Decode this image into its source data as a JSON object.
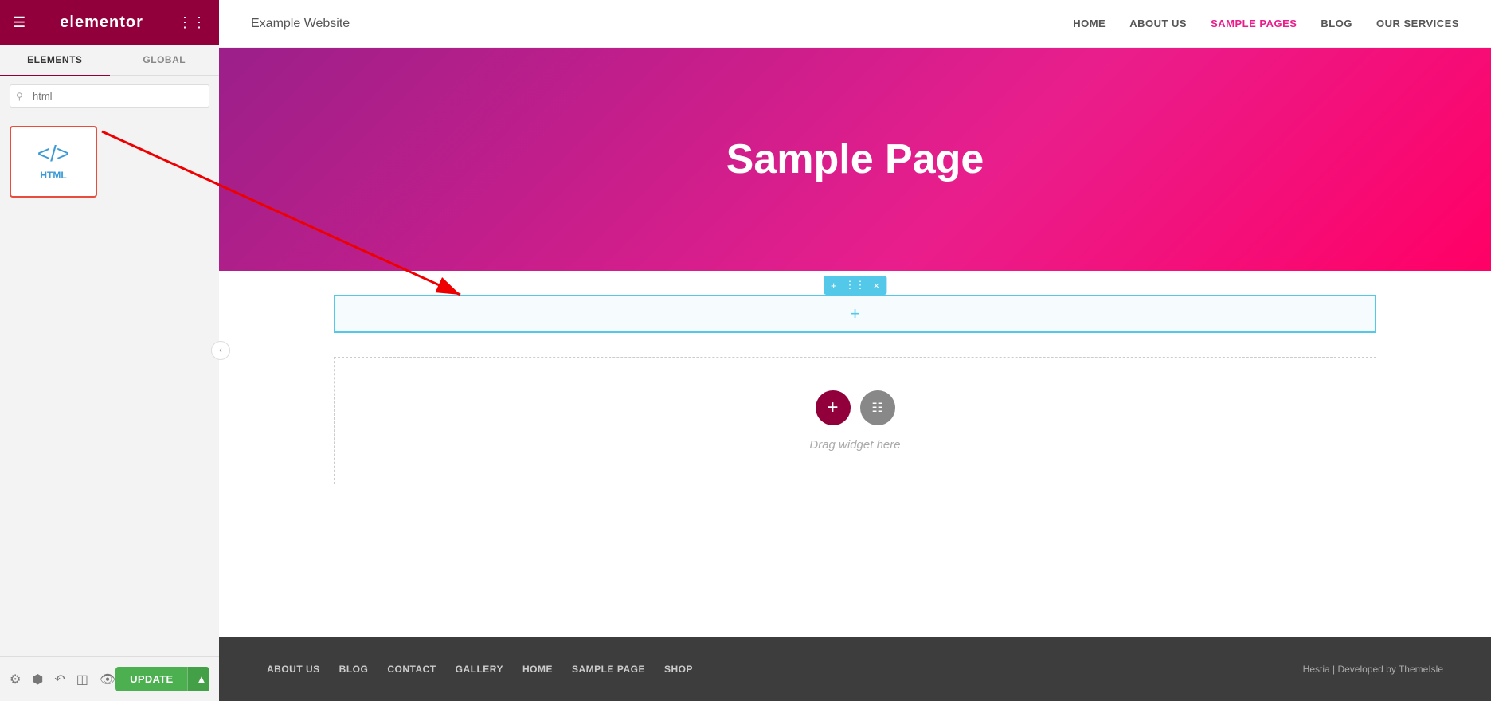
{
  "topbar": {
    "logo": "elementor",
    "hamburger_icon": "☰",
    "grid_icon": "⋮⋮"
  },
  "sidepanel": {
    "tabs": [
      {
        "id": "elements",
        "label": "ELEMENTS",
        "active": true
      },
      {
        "id": "global",
        "label": "GLOBAL",
        "active": false
      }
    ],
    "search_placeholder": "html",
    "widget": {
      "icon": "</>",
      "label": "HTML"
    }
  },
  "website": {
    "site_name": "Example Website",
    "nav_links": [
      {
        "label": "HOME",
        "active": false
      },
      {
        "label": "ABOUT US",
        "active": false
      },
      {
        "label": "SAMPLE PAGES",
        "active": true
      },
      {
        "label": "BLOG",
        "active": false
      },
      {
        "label": "OUR SERVICES",
        "active": false
      }
    ],
    "hero_title": "Sample Page",
    "selected_row_plus": "+",
    "drag_widget_label": "Drag widget here",
    "footer_links": [
      {
        "label": "ABOUT US"
      },
      {
        "label": "BLOG"
      },
      {
        "label": "CONTACT"
      },
      {
        "label": "GALLERY"
      },
      {
        "label": "HOME"
      },
      {
        "label": "SAMPLE PAGE"
      },
      {
        "label": "SHOP"
      }
    ],
    "footer_credit": "Hestia | Developed by ThemeIsle"
  },
  "bottom_toolbar": {
    "update_label": "UPDATE",
    "arrow_label": "▲",
    "icons": [
      "⚙",
      "⬡",
      "↶",
      "⊡",
      "👁"
    ]
  },
  "row_toolbar": {
    "plus": "+",
    "move": "⋮⋮",
    "close": "×"
  }
}
